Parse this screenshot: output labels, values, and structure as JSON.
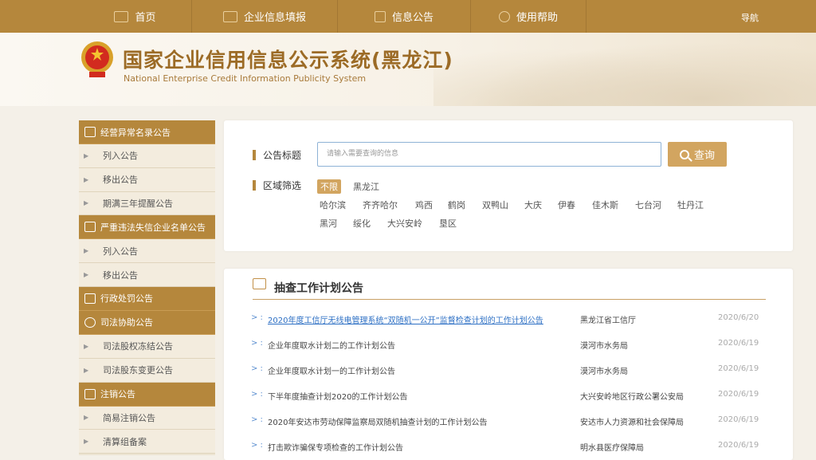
{
  "topnav": {
    "items": [
      {
        "label": "首页"
      },
      {
        "label": "企业信息填报"
      },
      {
        "label": "信息公告"
      },
      {
        "label": "使用帮助"
      }
    ],
    "guide": "导航"
  },
  "header": {
    "title_cn": "国家企业信用信息公示系统(黑龙江)",
    "title_en": "National Enterprise Credit Information Publicity System"
  },
  "sidebar": {
    "sections": [
      {
        "heading": "经营异常名录公告",
        "items": [
          "列入公告",
          "移出公告",
          "期满三年提醒公告"
        ]
      },
      {
        "heading": "严重违法失信企业名单公告",
        "items": [
          "列入公告",
          "移出公告"
        ]
      },
      {
        "heading": "行政处罚公告",
        "items": []
      },
      {
        "heading": "司法协助公告",
        "items": [
          "司法股权冻结公告",
          "司法股东变更公告"
        ]
      },
      {
        "heading": "注销公告",
        "items": [
          "简易注销公告",
          "清算组备案"
        ]
      }
    ]
  },
  "search": {
    "title_label": "公告标题",
    "placeholder": "请输入需要查询的信息",
    "button": "查询",
    "region_label": "区域筛选",
    "regions_row1": [
      "不限",
      "黑龙江"
    ],
    "regions_row2": [
      "哈尔滨",
      "齐齐哈尔",
      "鸡西",
      "鹤岗",
      "双鸭山",
      "大庆",
      "伊春",
      "佳木斯",
      "七台河",
      "牡丹江"
    ],
    "regions_row3": [
      "黑河",
      "绥化",
      "大兴安岭",
      "垦区"
    ]
  },
  "list": {
    "title": "抽查工作计划公告",
    "rows": [
      {
        "title": "2020年度工信厅无线电管理系统“双随机一公开”监督检查计划的工作计划公告",
        "org": "黑龙江省工信厅",
        "date": "2020/6/20"
      },
      {
        "title": "企业年度取水计划二的工作计划公告",
        "org": "漠河市水务局",
        "date": "2020/6/19"
      },
      {
        "title": "企业年度取水计划一的工作计划公告",
        "org": "漠河市水务局",
        "date": "2020/6/19"
      },
      {
        "title": "下半年度抽查计划2020的工作计划公告",
        "org": "大兴安岭地区行政公署公安局",
        "date": "2020/6/19"
      },
      {
        "title": "2020年安达市劳动保障监察局双随机抽查计划的工作计划公告",
        "org": "安达市人力资源和社会保障局",
        "date": "2020/6/19"
      },
      {
        "title": "打击欺诈骗保专项检查的工作计划公告",
        "org": "明水县医疗保障局",
        "date": "2020/6/19"
      }
    ]
  },
  "colors": {
    "accent": "#b5873c",
    "link": "#2c6fc4"
  }
}
